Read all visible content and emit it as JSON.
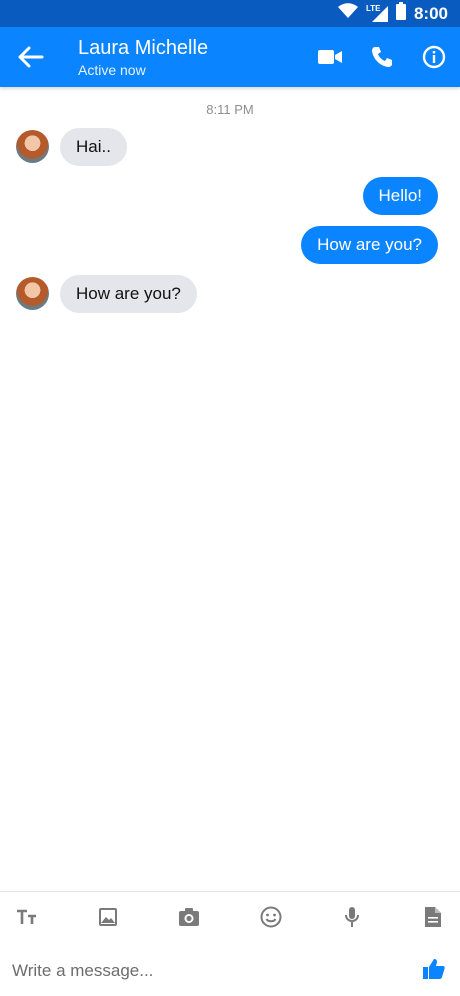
{
  "status_bar": {
    "time": "8:00",
    "network": "LTE"
  },
  "header": {
    "title": "Laura Michelle",
    "subtitle": "Active now"
  },
  "conversation": {
    "timestamp": "8:11 PM",
    "messages": [
      {
        "from": "Laura Michelle",
        "text": "Hai.."
      },
      {
        "from": "me",
        "text": "Hello!"
      },
      {
        "from": "me",
        "text": "How are you?"
      },
      {
        "from": "Laura Michelle",
        "text": "How are you?"
      }
    ]
  },
  "composer": {
    "placeholder": "Write a message..."
  },
  "icons": {
    "back": "arrow-left-icon",
    "video": "video-camera-icon",
    "phone": "phone-icon",
    "info": "info-icon",
    "text": "text-format-icon",
    "gallery": "image-icon",
    "camera": "camera-icon",
    "emoji": "emoji-icon",
    "mic": "microphone-icon",
    "file": "file-icon",
    "like": "thumbs-up-icon"
  },
  "colors": {
    "accent": "#0a84ff",
    "status_bar": "#0a5bbf",
    "incoming_bubble": "#e4e6eb"
  }
}
